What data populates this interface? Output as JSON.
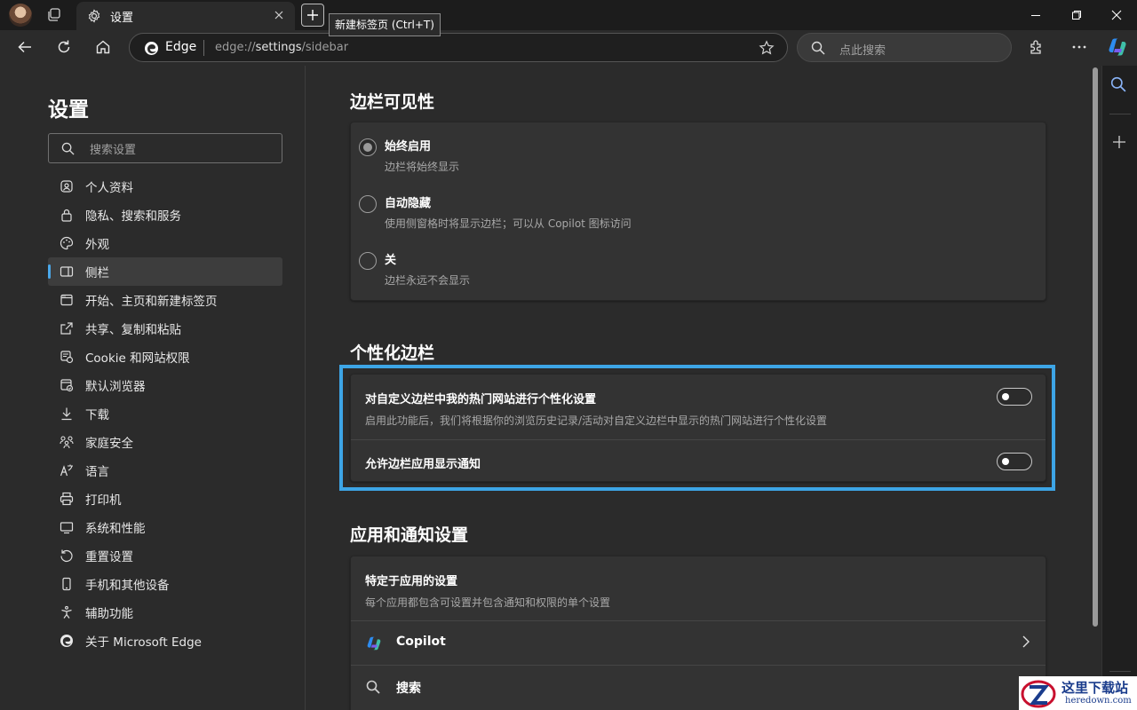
{
  "window": {
    "tab_title": "设置",
    "new_tab_tooltip": "新建标签页 (Ctrl+T)"
  },
  "address_bar": {
    "site_label": "Edge",
    "url_prefix": "edge://",
    "url_main": "settings",
    "url_suffix": "/sidebar"
  },
  "search_box": {
    "placeholder": "点此搜索"
  },
  "left_nav": {
    "title": "设置",
    "search_placeholder": "搜索设置",
    "items": [
      {
        "label": "个人资料",
        "icon": "profile-icon"
      },
      {
        "label": "隐私、搜索和服务",
        "icon": "lock-icon"
      },
      {
        "label": "外观",
        "icon": "palette-icon"
      },
      {
        "label": "侧栏",
        "icon": "sidebar-icon",
        "active": true
      },
      {
        "label": "开始、主页和新建标签页",
        "icon": "home-page-icon"
      },
      {
        "label": "共享、复制和粘贴",
        "icon": "share-icon"
      },
      {
        "label": "Cookie 和网站权限",
        "icon": "cookie-icon"
      },
      {
        "label": "默认浏览器",
        "icon": "default-browser-icon"
      },
      {
        "label": "下载",
        "icon": "download-icon"
      },
      {
        "label": "家庭安全",
        "icon": "family-icon"
      },
      {
        "label": "语言",
        "icon": "language-icon"
      },
      {
        "label": "打印机",
        "icon": "printer-icon"
      },
      {
        "label": "系统和性能",
        "icon": "system-icon"
      },
      {
        "label": "重置设置",
        "icon": "reset-icon"
      },
      {
        "label": "手机和其他设备",
        "icon": "phone-icon"
      },
      {
        "label": "辅助功能",
        "icon": "accessibility-icon"
      },
      {
        "label": "关于 Microsoft Edge",
        "icon": "edge-logo-icon"
      }
    ]
  },
  "visibility": {
    "title": "边栏可见性",
    "options": [
      {
        "title": "始终启用",
        "desc": "边栏将始终显示",
        "selected": true
      },
      {
        "title": "自动隐藏",
        "desc": "使用侧窗格时将显示边栏；可以从 Copilot 图标访问",
        "selected": false
      },
      {
        "title": "关",
        "desc": "边栏永远不会显示",
        "selected": false
      }
    ]
  },
  "personalize": {
    "title": "个性化边栏",
    "rows": [
      {
        "title": "对自定义边栏中我的热门网站进行个性化设置",
        "desc": "启用此功能后，我们将根据你的浏览历史记录/活动对自定义边栏中显示的热门网站进行个性化设置",
        "enabled": false
      },
      {
        "title": "允许边栏应用显示通知",
        "enabled": false
      }
    ]
  },
  "app_settings": {
    "title": "应用和通知设置",
    "header_title": "特定于应用的设置",
    "header_desc": "每个应用都包含可设置并包含通知和权限的单个设置",
    "apps": [
      {
        "label": "Copilot",
        "icon": "copilot-icon"
      },
      {
        "label": "搜索",
        "icon": "search-icon"
      }
    ]
  },
  "watermark": {
    "title": "这里下载站",
    "url": "heredown.com"
  },
  "colors": {
    "accent": "#4aa8ea",
    "highlight_border": "#3da5e6",
    "background": "#2b2b2b"
  }
}
